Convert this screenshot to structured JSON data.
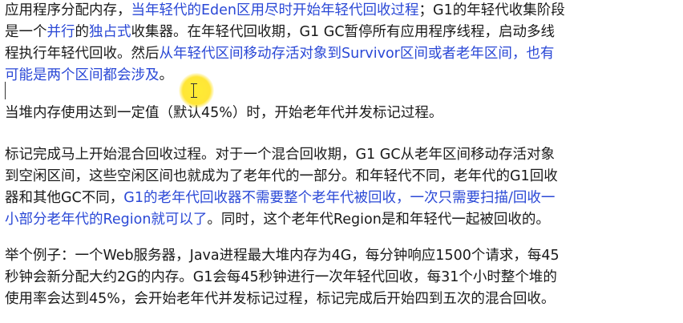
{
  "para1": {
    "l1": [
      {
        "t": "应用程序分配内存，",
        "c": "n"
      },
      {
        "t": "当年轻代的Eden区用尽时开始年轻代回收过程",
        "c": "b"
      },
      {
        "t": "；G1的年轻代收集阶段",
        "c": "n"
      }
    ],
    "l2": [
      {
        "t": "是一个",
        "c": "n"
      },
      {
        "t": "并行",
        "c": "b"
      },
      {
        "t": "的",
        "c": "n"
      },
      {
        "t": "独占式",
        "c": "b"
      },
      {
        "t": "收集器。在年轻代回收期，G1 GC暂停所有应用程序线程，启动多线",
        "c": "n"
      }
    ],
    "l3": [
      {
        "t": "程执行年轻代回收。然后",
        "c": "n"
      },
      {
        "t": "从年轻代区间移动存活对象到Survivor区间或者老年区间，也有",
        "c": "b"
      }
    ],
    "l4": [
      {
        "t": "可能是两个区间都会涉及",
        "c": "b"
      },
      {
        "t": "。",
        "c": "n"
      }
    ]
  },
  "para2": {
    "l1": [
      {
        "t": "当堆内存使用达到一定值（默认45%）时，开始老年代并发标记过程。",
        "c": "n"
      }
    ]
  },
  "para3": {
    "l1": [
      {
        "t": "标记完成马上开始混合回收过程。对于一个混合回收期，G1 GC从老年区间移动存活对象",
        "c": "n"
      }
    ],
    "l2": [
      {
        "t": "到空闲区间，这些空闲区间也就成为了老年代的一部分。和年轻代不同，老年代的G1回收",
        "c": "n"
      }
    ],
    "l3": [
      {
        "t": "器和其他GC不同，",
        "c": "n"
      },
      {
        "t": "G1的老年代回收器不需要整个老年代被回收，一次只需要扫描/回收一",
        "c": "b"
      }
    ],
    "l4": [
      {
        "t": "小部分老年代的Region就可以了",
        "c": "b"
      },
      {
        "t": "。同时，这个老年代Region是和年轻代一起被回收的。",
        "c": "n"
      }
    ]
  },
  "para4": {
    "l1": [
      {
        "t": "举个例子：一个Web服务器，Java进程最大堆内存为4G，每分钟响应1500个请求，每45",
        "c": "n"
      }
    ],
    "l2": [
      {
        "t": "秒钟会新分配大约2G的内存。G1会每45秒钟进行一次年轻代回收，每31个小时整个堆的",
        "c": "n"
      }
    ],
    "l3": [
      {
        "t": "使用率会达到45%，会开始老年代并发标记过程，标记完成后开始四到五次的混合回收。",
        "c": "n"
      }
    ]
  }
}
